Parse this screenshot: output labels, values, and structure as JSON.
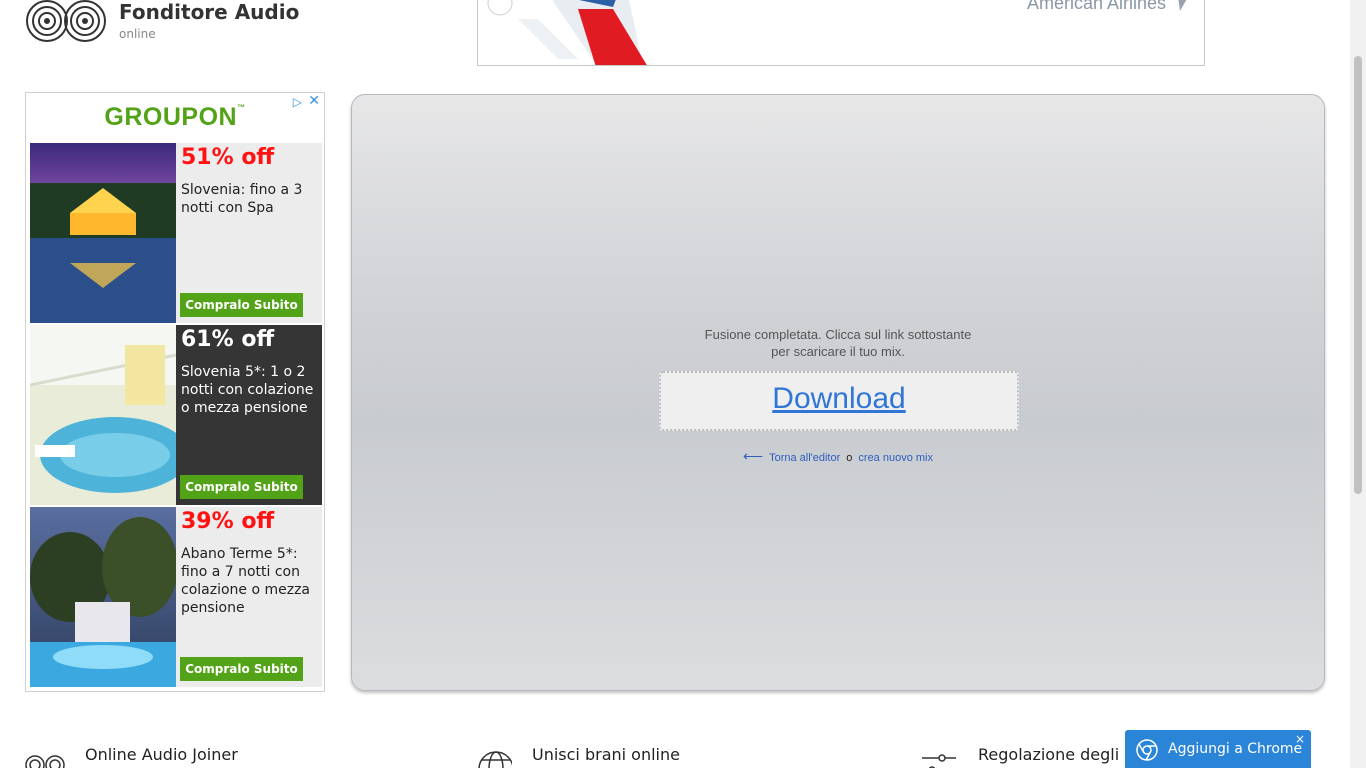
{
  "header": {
    "title": "Fonditore Audio",
    "subtitle": "online"
  },
  "top_ad": {
    "text": "American Airlines"
  },
  "side_ad": {
    "brand": "GROUPON",
    "deals": [
      {
        "percent": "51% off",
        "description": "Slovenia: fino a 3 notti con Spa",
        "button": "Compralo Subito"
      },
      {
        "percent": "61% off",
        "description": "Slovenia 5*: 1 o 2 notti con colazione o mezza pensione",
        "button": "Compralo Subito"
      },
      {
        "percent": "39% off",
        "description": "Abano Terme 5*: fino a 7 notti con colazione o mezza pensione",
        "button": "Compralo Subito"
      }
    ]
  },
  "panel": {
    "message_line1": "Fusione completata. Clicca sul link sottostante",
    "message_line2": "per scaricare il tuo mix.",
    "download_label": "Download",
    "back_arrow": "⟵",
    "back_label": "Torna all'editor",
    "or_label": "o",
    "new_mix_label": "crea nuovo mix"
  },
  "features": [
    {
      "title": "Online Audio Joiner",
      "icon": "vinyl-icon"
    },
    {
      "title": "Unisci brani online",
      "icon": "globe-icon"
    },
    {
      "title": "Regolazione degli intervalli",
      "icon": "sliders-icon"
    }
  ],
  "chrome_bar": {
    "label": "Aggiungi a Chrome",
    "close": "×"
  },
  "colors": {
    "groupon_green": "#53a318",
    "deal_red": "#ff1212",
    "link_blue": "#2f76d6",
    "chrome_blue": "#2a84d8"
  }
}
